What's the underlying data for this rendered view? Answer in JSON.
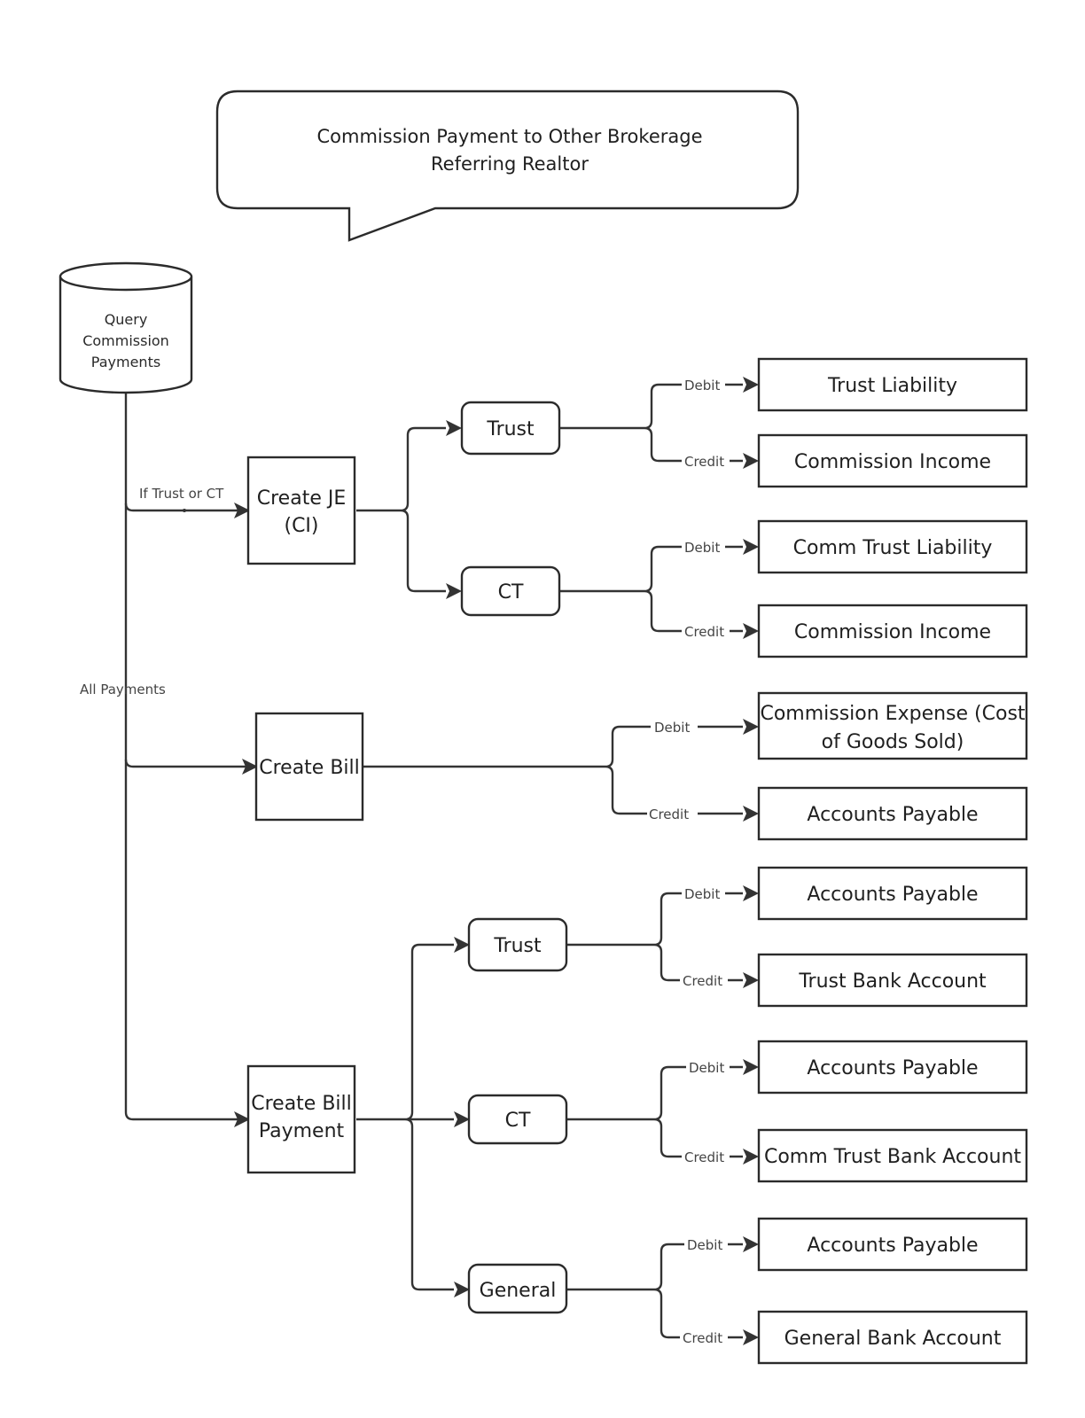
{
  "callout": {
    "lines": [
      "Commission Payment to Other Brokerage",
      "Referring Realtor"
    ]
  },
  "source": {
    "lines": [
      "Query",
      "Commission",
      "Payments"
    ]
  },
  "edge_labels": {
    "if_trust_or_ct": "If Trust or CT",
    "all_payments": "All Payments",
    "debit": "Debit",
    "credit": "Credit"
  },
  "processes": [
    {
      "id": "create-je",
      "lines": [
        "Create JE",
        "(CI)"
      ],
      "branches": [
        {
          "label": "Trust",
          "debit": [
            "Trust Liability"
          ],
          "credit": [
            "Commission Income"
          ]
        },
        {
          "label": "CT",
          "debit": [
            "Comm Trust Liability"
          ],
          "credit": [
            "Commission Income"
          ]
        }
      ]
    },
    {
      "id": "create-bill",
      "lines": [
        "Create Bill"
      ],
      "debit": [
        "Commission Expense (Cost",
        "of Goods Sold)"
      ],
      "credit": [
        "Accounts Payable"
      ]
    },
    {
      "id": "create-bill-payment",
      "lines": [
        "Create Bill",
        "Payment"
      ],
      "branches": [
        {
          "label": "Trust",
          "debit": [
            "Accounts Payable"
          ],
          "credit": [
            "Trust Bank Account"
          ]
        },
        {
          "label": "CT",
          "debit": [
            "Accounts Payable"
          ],
          "credit": [
            "Comm Trust Bank Account"
          ]
        },
        {
          "label": "General",
          "debit": [
            "Accounts Payable"
          ],
          "credit": [
            "General Bank Account"
          ]
        }
      ]
    }
  ],
  "colors": {
    "stroke": "#2b2b2b",
    "text": "#1f1f1f",
    "edge_label": "#444444",
    "background": "#ffffff"
  }
}
